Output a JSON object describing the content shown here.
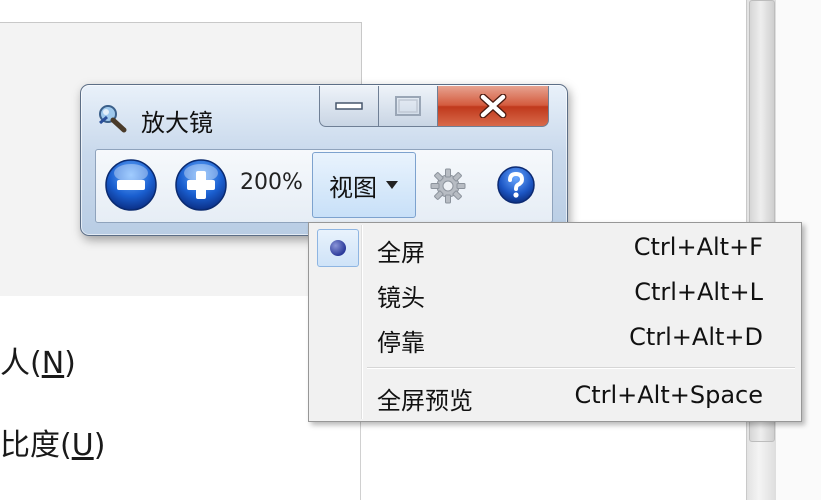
{
  "window": {
    "title": "放大镜",
    "zoom_level": "200%",
    "view_label": "视图",
    "buttons": {
      "minimize": "minimize",
      "maximize": "maximize",
      "close": "close"
    }
  },
  "menu": {
    "items": [
      {
        "label": "全屏",
        "shortcut": "Ctrl+Alt+F",
        "selected": true
      },
      {
        "label": "镜头",
        "shortcut": "Ctrl+Alt+L",
        "selected": false
      },
      {
        "label": "停靠",
        "shortcut": "Ctrl+Alt+D",
        "selected": false
      },
      {
        "label": "全屏预览",
        "shortcut": "Ctrl+Alt+Space",
        "selected": false
      }
    ]
  },
  "background": {
    "line1_prefix": "人(",
    "line1_key": "N",
    "line1_suffix": ")",
    "line2_prefix": "比度(",
    "line2_key": "U",
    "line2_suffix": ")"
  },
  "colors": {
    "close_red": "#c9452a",
    "accent_blue": "#1f5fc4",
    "radio_dot": "#2b3a9a"
  },
  "icons": {
    "title_icon": "magnifier-icon",
    "zoom_out": "minus-icon",
    "zoom_in": "plus-icon",
    "options": "gear-icon",
    "help": "help-icon",
    "dropdown": "triangle-down-icon"
  }
}
